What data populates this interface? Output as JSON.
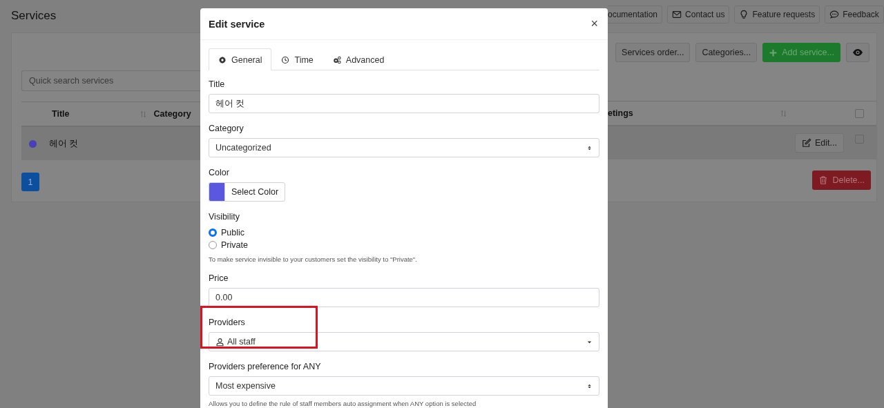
{
  "page": {
    "title": "Services"
  },
  "header_buttons": [
    {
      "label": "ocumentation"
    },
    {
      "label": "Contact us"
    },
    {
      "label": "Feature requests"
    },
    {
      "label": "Feedback"
    }
  ],
  "toolbar": [
    {
      "label": "Services order...",
      "kind": "default"
    },
    {
      "label": "Categories...",
      "kind": "default"
    },
    {
      "label": "Add service...",
      "kind": "success"
    },
    {
      "kind": "icon"
    }
  ],
  "search": {
    "placeholder": "Quick search services"
  },
  "table": {
    "columns": [
      {
        "label": "Title",
        "sortable": true
      },
      {
        "label": "Category",
        "sortable": false
      }
    ],
    "columns_right": [
      {
        "label": "etings",
        "sortable": true
      }
    ],
    "header_checked": false,
    "rows": [
      {
        "color": "#4a3fb5",
        "title": "헤어 컷",
        "edit": "Edit...",
        "checked": false
      }
    ]
  },
  "pagination": [
    {
      "label": "1",
      "selected": true
    }
  ],
  "delete_button": "Delete...",
  "modal": {
    "title": "Edit service",
    "close": "×",
    "tabs": [
      {
        "label": "General",
        "selected": true
      },
      {
        "label": "Time",
        "selected": false
      },
      {
        "label": "Advanced",
        "selected": false
      }
    ],
    "fields": [
      {
        "kind": "text",
        "label": "Title",
        "value": "헤어 컷"
      },
      {
        "kind": "select",
        "label": "Category",
        "value": "Uncategorized"
      },
      {
        "kind": "color",
        "label": "Color",
        "color": "#5b57e0",
        "button": "Select Color"
      },
      {
        "kind": "radio",
        "label": "Visibility",
        "options": [
          {
            "label": "Public",
            "selected": true
          },
          {
            "label": "Private",
            "selected": false
          }
        ],
        "help": "To make service invisible to your customers set the visibility to \"Private\"."
      },
      {
        "kind": "text",
        "label": "Price",
        "value": "0.00"
      },
      {
        "kind": "dropdown",
        "label": "Providers",
        "value": "All staff",
        "highlighted": true
      },
      {
        "kind": "select",
        "label": "Providers preference for ANY",
        "value": "Most expensive",
        "help": "Allows you to define the rule of staff members auto assignment when ANY option is selected"
      }
    ]
  }
}
